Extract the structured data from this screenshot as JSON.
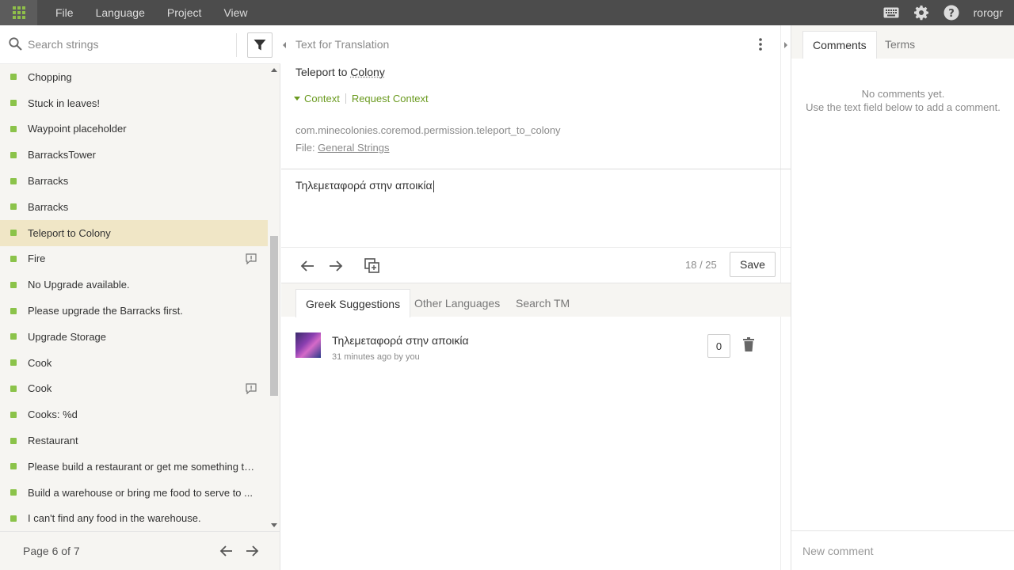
{
  "topbar": {
    "menu": [
      "File",
      "Language",
      "Project",
      "View"
    ],
    "username": "rorogr"
  },
  "search": {
    "placeholder": "Search strings",
    "value": ""
  },
  "strings": [
    {
      "text": "Chopping",
      "selected": false,
      "has_comment": false
    },
    {
      "text": "Stuck in leaves!",
      "selected": false,
      "has_comment": false
    },
    {
      "text": "Waypoint placeholder",
      "selected": false,
      "has_comment": false
    },
    {
      "text": "BarracksTower",
      "selected": false,
      "has_comment": false
    },
    {
      "text": "Barracks",
      "selected": false,
      "has_comment": false
    },
    {
      "text": "Barracks",
      "selected": false,
      "has_comment": false
    },
    {
      "text": "Teleport to Colony",
      "selected": true,
      "has_comment": false
    },
    {
      "text": "Fire",
      "selected": false,
      "has_comment": true
    },
    {
      "text": "No Upgrade available.",
      "selected": false,
      "has_comment": false
    },
    {
      "text": "Please upgrade the Barracks first.",
      "selected": false,
      "has_comment": false
    },
    {
      "text": "Upgrade Storage",
      "selected": false,
      "has_comment": false
    },
    {
      "text": "Cook",
      "selected": false,
      "has_comment": false
    },
    {
      "text": "Cook",
      "selected": false,
      "has_comment": true
    },
    {
      "text": "Cooks: %d",
      "selected": false,
      "has_comment": false
    },
    {
      "text": "Restaurant",
      "selected": false,
      "has_comment": false
    },
    {
      "text": "Please build a restaurant or get me something to ...",
      "selected": false,
      "has_comment": false
    },
    {
      "text": "Build a warehouse or bring me food to serve to ...",
      "selected": false,
      "has_comment": false
    },
    {
      "text": "I can't find any food in the warehouse.",
      "selected": false,
      "has_comment": false
    }
  ],
  "pager": {
    "label": "Page 6 of 7"
  },
  "source": {
    "section_title": "Text for Translation",
    "text_before": "Teleport to ",
    "text_term": "Colony",
    "context_label": "Context",
    "request_context_label": "Request Context",
    "key": "com.minecolonies.coremod.permission.teleport_to_colony",
    "file_prefix": "File: ",
    "file_name": "General Strings"
  },
  "editor": {
    "translation": "Τηλεμεταφορά στην αποικία",
    "counter": "18 / 25",
    "save_label": "Save"
  },
  "suggestion_tabs": [
    "Greek Suggestions",
    "Other Languages",
    "Search TM"
  ],
  "suggestion": {
    "text": "Τηλεμεταφορά στην αποικία",
    "meta": "31 minutes ago by you",
    "votes": "0"
  },
  "right": {
    "tabs": [
      "Comments",
      "Terms"
    ],
    "no_comments_line1": "No comments yet.",
    "no_comments_line2": "Use the text field below to add a comment.",
    "new_comment_placeholder": "New comment"
  },
  "colors": {
    "accent_green": "#8bc34a",
    "selected_row": "#f0e6c6",
    "topbar": "#4c4c4c"
  }
}
